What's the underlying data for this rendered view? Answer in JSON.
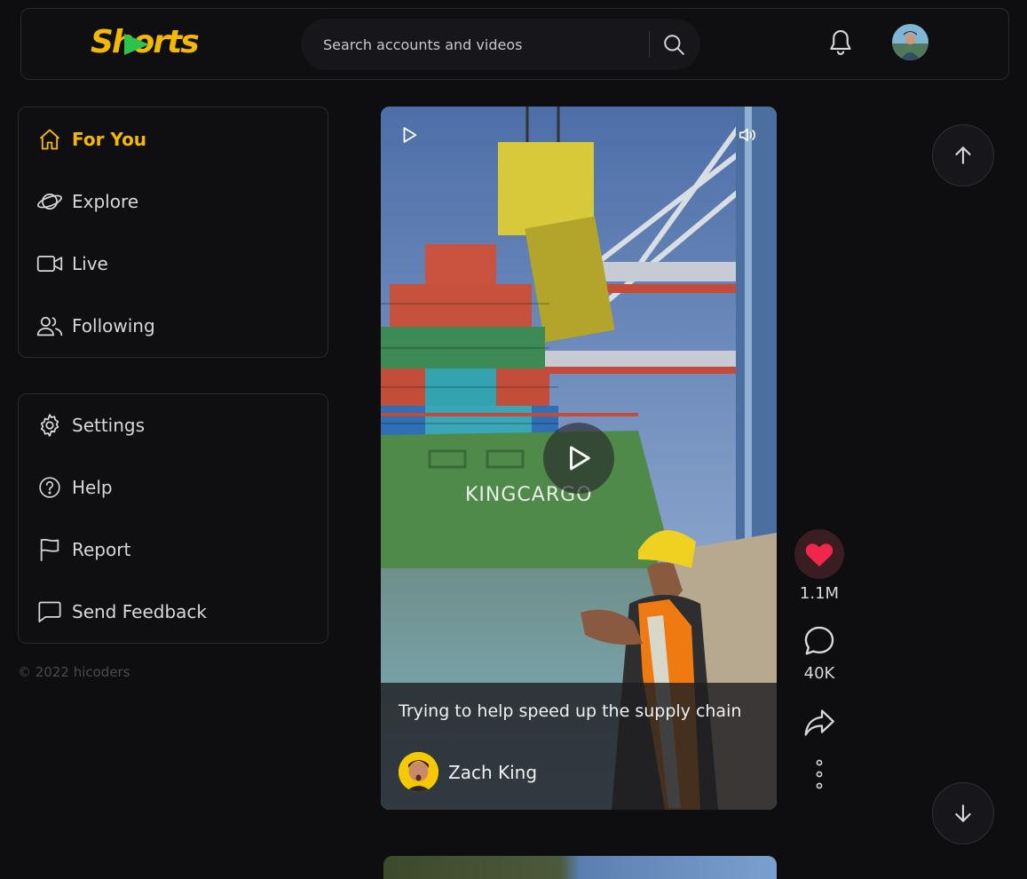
{
  "header": {
    "logo_text": "Shorts",
    "search_placeholder": "Search accounts and videos",
    "icons": [
      "search-icon",
      "bell-icon",
      "user-avatar"
    ]
  },
  "sidebar": {
    "nav": [
      {
        "label": "For You",
        "icon": "home-icon",
        "active": true
      },
      {
        "label": "Explore",
        "icon": "planet-icon",
        "active": false
      },
      {
        "label": "Live",
        "icon": "video-camera-icon",
        "active": false
      },
      {
        "label": "Following",
        "icon": "users-icon",
        "active": false
      }
    ],
    "misc": [
      {
        "label": "Settings",
        "icon": "gear-icon"
      },
      {
        "label": "Help",
        "icon": "help-icon"
      },
      {
        "label": "Report",
        "icon": "flag-icon"
      },
      {
        "label": "Send Feedback",
        "icon": "message-icon"
      }
    ],
    "copyright": "© 2022 hicoders"
  },
  "video": {
    "title": "Trying to help speed up the supply chain",
    "author": "Zach King",
    "ship_text": "KINGCARGO"
  },
  "actions": {
    "likes": "1.1M",
    "comments": "40K"
  },
  "colors": {
    "accent": "#f5b800",
    "like": "#f0264a",
    "background": "#0e0e11"
  }
}
